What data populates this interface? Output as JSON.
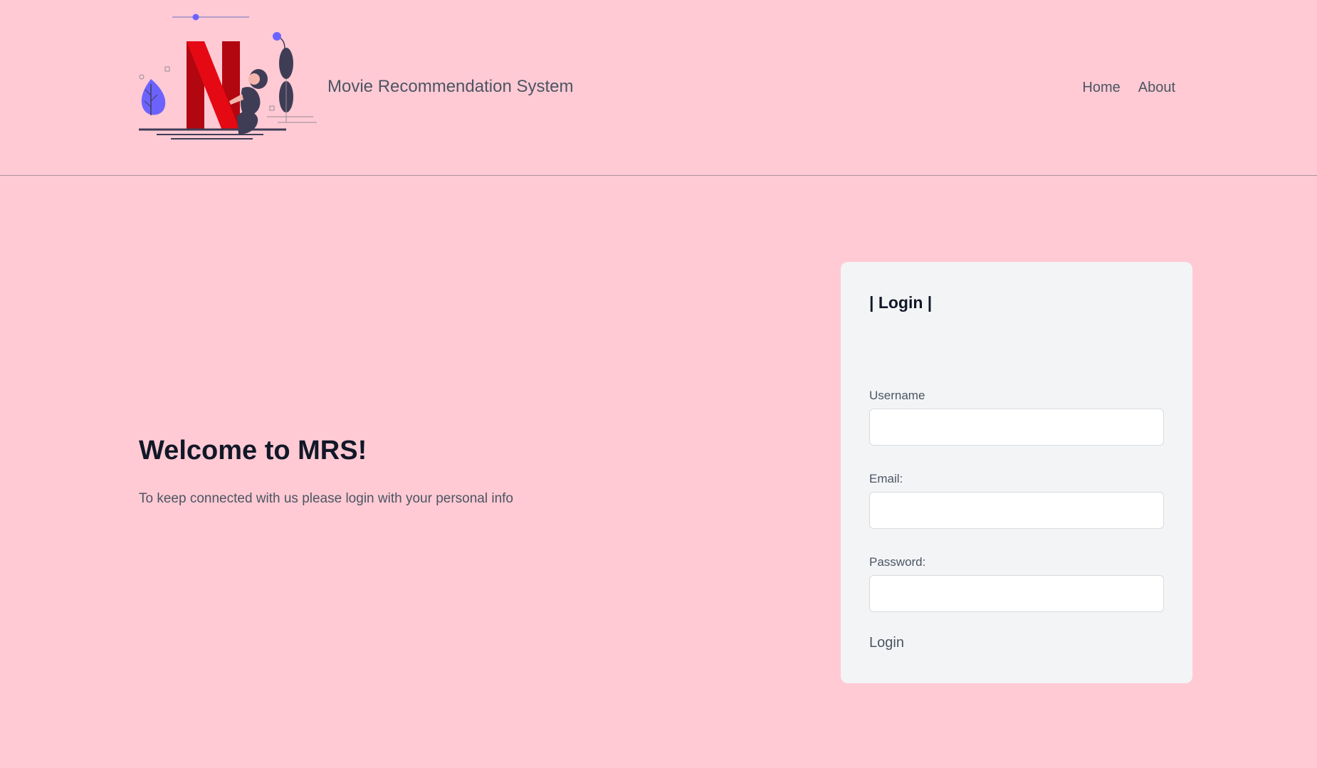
{
  "header": {
    "brand": "Movie Recommendation System",
    "nav": [
      "Home",
      "About"
    ]
  },
  "welcome": {
    "title": "Welcome to MRS!",
    "text": "To keep connected with us please login with your personal info"
  },
  "login_card": {
    "title": "| Login |",
    "fields": [
      {
        "label": "Username",
        "value": "",
        "placeholder": ""
      },
      {
        "label": "Email:",
        "value": "",
        "placeholder": ""
      },
      {
        "label": "Password:",
        "value": "",
        "placeholder": ""
      }
    ],
    "submit_label": "Login"
  },
  "colors": {
    "background": "#ffcad4",
    "card": "#f3f4f6",
    "logo_red": "#e50914",
    "logo_dark_red": "#b20710",
    "accent_purple": "#6c63ff",
    "figure_dark": "#3f3d56"
  },
  "icons": [
    "netflix-illustration-logo",
    "leaf-icon"
  ]
}
